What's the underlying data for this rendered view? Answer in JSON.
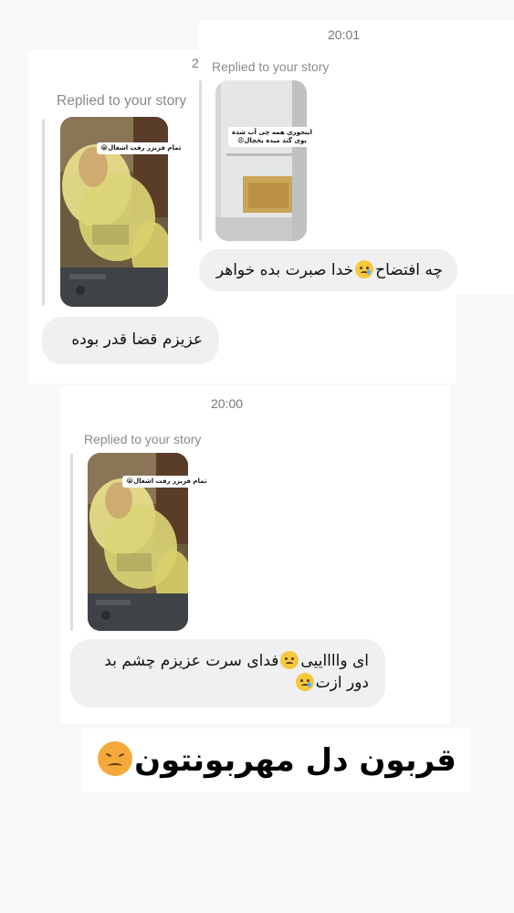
{
  "screenshot_top": {
    "timestamp_partial": "2",
    "replied_label": "Replied to your story",
    "story_caption": "تمام فریزر رفت اشغال😭",
    "message": "عزیزم قضا قدر بوده"
  },
  "screenshot_right": {
    "timestamp": "20:01",
    "replied_label": "Replied to your story",
    "story_caption_line1": "اینجوری همه چی آب شده",
    "story_caption_line2": "بوی گند میده یخچال😩",
    "message_part1": "چه افتضاح",
    "message_part2": "خدا صبرت بده خواهر"
  },
  "screenshot_bottom": {
    "timestamp": "20:00",
    "replied_label": "Replied to your story",
    "story_caption": "تمام فریزر رفت اشغال😭",
    "message_line1_part1": "ای وااااییی",
    "message_line1_part2": "فدای سرت عزیزم چشم بد",
    "message_line2": "دور ازت"
  },
  "overlay_caption": "قربون دل مهربونتون",
  "icons": {
    "crying_face": "crying-face-emoji",
    "frowning_face": "frowning-face-emoji",
    "sad_tear_face": "sad-tear-emoji",
    "confounded_face": "confounded-face-emoji"
  },
  "colors": {
    "bubble": "#eff0f2",
    "muted_text": "#8a8a8a",
    "timestamp": "#777777",
    "emoji_yellow": "#f6c83c"
  }
}
